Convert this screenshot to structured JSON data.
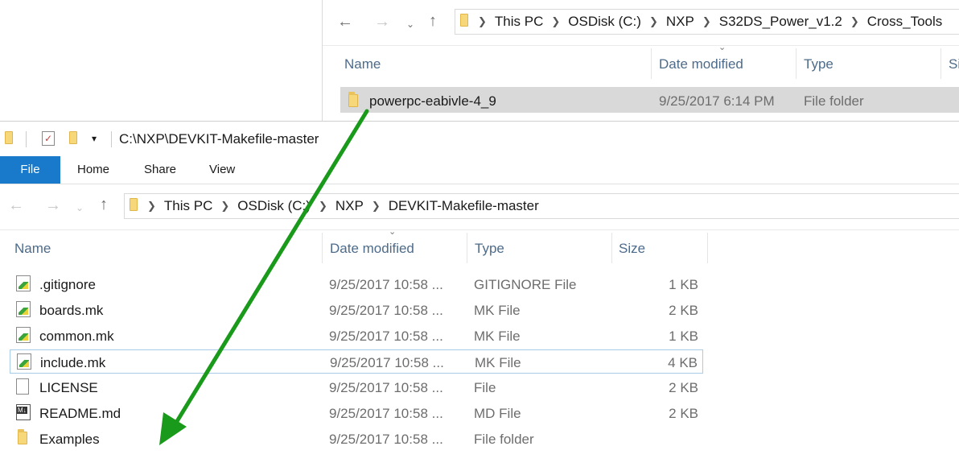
{
  "top_window": {
    "breadcrumb": [
      "This PC",
      "OSDisk (C:)",
      "NXP",
      "S32DS_Power_v1.2",
      "Cross_Tools"
    ],
    "columns": [
      "Name",
      "Date modified",
      "Type",
      "Si"
    ],
    "rows": [
      {
        "name": "powerpc-eabivle-4_9",
        "date": "9/25/2017 6:14 PM",
        "type": "File folder"
      }
    ]
  },
  "front_window": {
    "title": "C:\\NXP\\DEVKIT-Makefile-master",
    "ribbon_tabs": [
      "File",
      "Home",
      "Share",
      "View"
    ],
    "breadcrumb": [
      "This PC",
      "OSDisk (C:)",
      "NXP",
      "DEVKIT-Makefile-master"
    ],
    "columns": [
      "Name",
      "Date modified",
      "Type",
      "Size"
    ],
    "files": [
      {
        "name": ".gitignore",
        "date": "9/25/2017 10:58 ...",
        "type": "GITIGNORE File",
        "size": "1 KB",
        "icon": "makefile-icon"
      },
      {
        "name": "boards.mk",
        "date": "9/25/2017 10:58 ...",
        "type": "MK File",
        "size": "2 KB",
        "icon": "makefile-icon"
      },
      {
        "name": "common.mk",
        "date": "9/25/2017 10:58 ...",
        "type": "MK File",
        "size": "1 KB",
        "icon": "makefile-icon"
      },
      {
        "name": "include.mk",
        "date": "9/25/2017 10:58 ...",
        "type": "MK File",
        "size": "4 KB",
        "icon": "makefile-icon"
      },
      {
        "name": "LICENSE",
        "date": "9/25/2017 10:58 ...",
        "type": "File",
        "size": "2 KB",
        "icon": "file-icon"
      },
      {
        "name": "README.md",
        "date": "9/25/2017 10:58 ...",
        "type": "MD File",
        "size": "2 KB",
        "icon": "markdown-icon"
      },
      {
        "name": "Examples",
        "date": "9/25/2017 10:58 ...",
        "type": "File folder",
        "size": "",
        "icon": "folder-icon"
      }
    ]
  },
  "annotation": {
    "arrow_color": "#1a9a1a"
  }
}
